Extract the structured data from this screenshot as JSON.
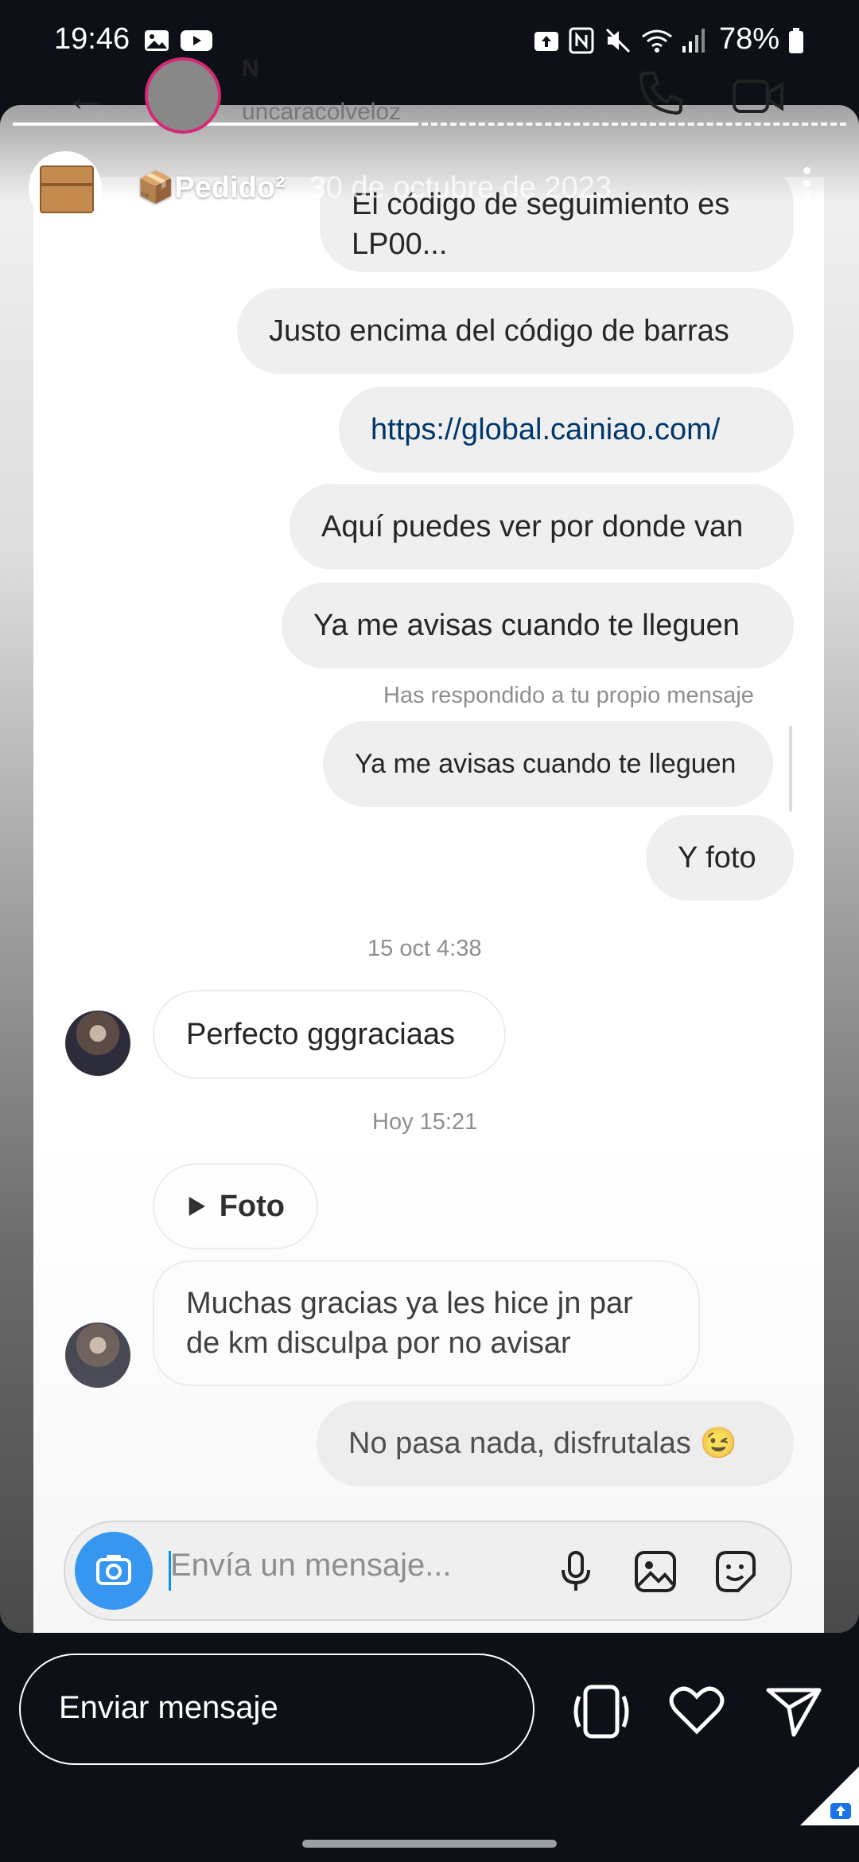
{
  "status_bar": {
    "time": "19:46",
    "battery": "78%",
    "icons": [
      "image-icon",
      "youtube-icon",
      "upload-icon",
      "nfc-icon",
      "mute-icon",
      "wifi-icon",
      "signal-icon",
      "battery-icon"
    ]
  },
  "story": {
    "title": "📦Pedido²",
    "date": "30 de octubre de 2023"
  },
  "dm": {
    "contact_name": "N",
    "contact_handle": "uncaracolveloz",
    "messages": [
      {
        "text": "El código de seguimiento es LP00..."
      },
      {
        "text": "Justo encima del código de barras"
      },
      {
        "text": "https://global.cainiao.com/"
      },
      {
        "text": "Aquí puedes ver por donde van"
      },
      {
        "text": "Ya me avisas cuando te lleguen"
      },
      {
        "text": "Has respondido a tu propio mensaje"
      },
      {
        "text": "Ya me avisas cuando te lleguen"
      },
      {
        "text": "Y foto"
      },
      {
        "text": "15 oct 4:38"
      },
      {
        "text": "Perfecto gggraciaas"
      },
      {
        "text": "Hoy 15:21"
      },
      {
        "text": "Foto"
      },
      {
        "text": "Muchas gracias ya les hice jn par de km disculpa por no avisar"
      },
      {
        "text": "No pasa nada, disfrutalas 😉"
      }
    ],
    "composer_placeholder": "Envía un mensaje..."
  },
  "bottom_bar": {
    "reply_placeholder": "Enviar mensaje"
  },
  "colors": {
    "accent": "#3797f0",
    "link": "#00376b",
    "background": "#0d1117"
  }
}
